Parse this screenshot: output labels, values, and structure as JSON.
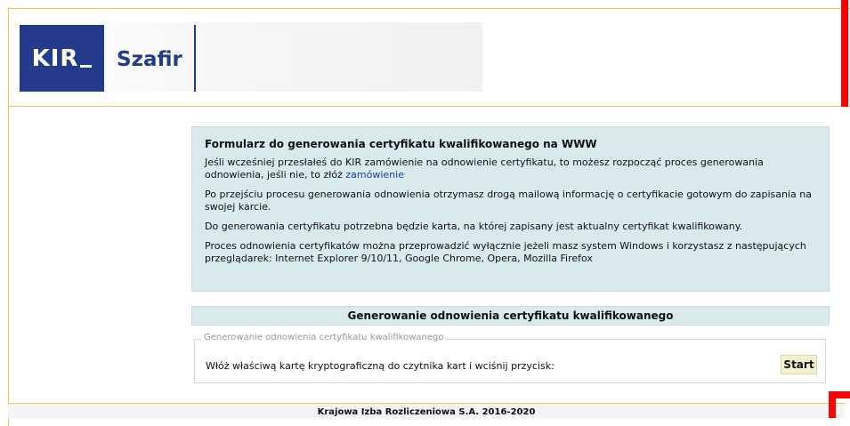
{
  "brand": {
    "kir_label": "KIR",
    "szafir_label": "Szafir",
    "brand_color": "#233a8d"
  },
  "info": {
    "title": "Formularz do generowania certyfikatu kwalifikowanego na WWW",
    "p1_text": "Jeśli wcześniej przesłałeś do KIR zamówienie na odnowienie certyfikatu, to możesz rozpocząć proces generowania odnowienia, jeśli nie, to złóż",
    "p1_link": "zamówienie",
    "p2": "Po przejściu procesu generowania odnowienia otrzymasz drogą mailową informację o certyfikacie gotowym do zapisania na swojej karcie.",
    "p3": "Do generowania certyfikatu potrzebna będzie karta, na której zapisany jest aktualny certyfikat kwalifikowany.",
    "p4": "Proces odnowienia certyfikatów można przeprowadzić wyłącznie jeżeli masz system Windows i korzystasz z następujących przeglądarek: Internet Explorer 9/10/11, Google Chrome, Opera, Mozilla Firefox"
  },
  "generator": {
    "header": "Generowanie odnowienia certyfikatu kwalifikowanego",
    "legend": "Generowanie odnowienia certyfikatu kwalifikowanego",
    "instruction": "Włóż właściwą kartę kryptograficzną do czytnika kart i wciśnij przycisk:",
    "start_label": "Start"
  },
  "footer": {
    "text": "Krajowa Izba Rozliczeniowa S.A. 2016-2020"
  },
  "colors": {
    "info_bg": "#d9eaec",
    "accent_border": "#e6c94a",
    "start_bg": "#f3f0cf",
    "annotation_red": "#ff0000"
  }
}
